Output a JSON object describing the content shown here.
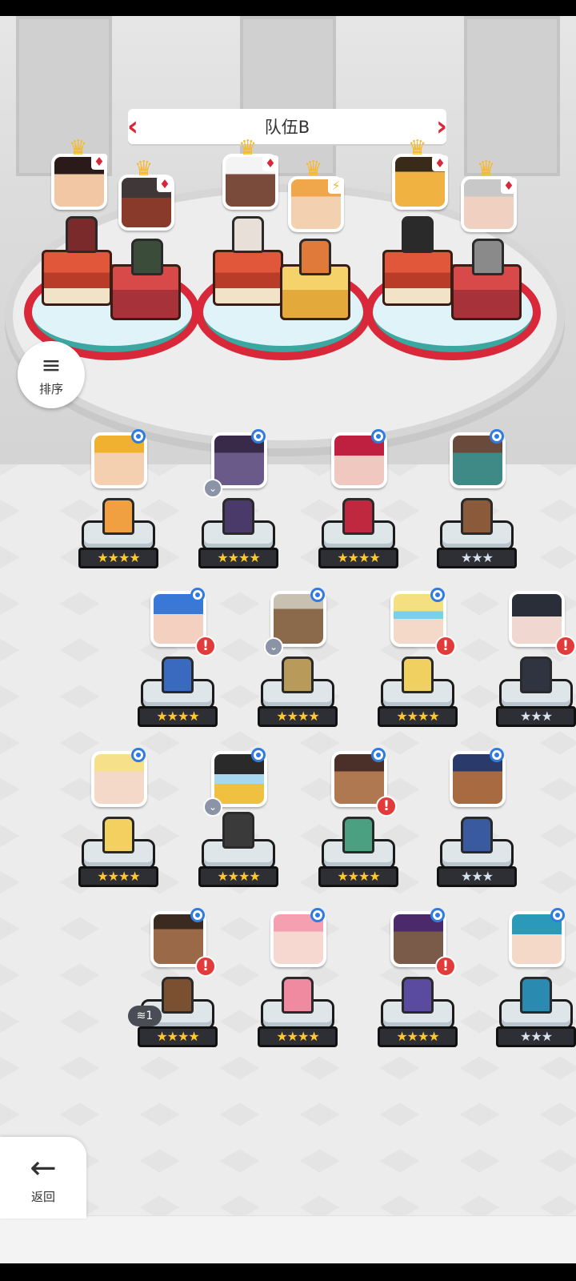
{
  "team": {
    "name": "队伍B"
  },
  "buttons": {
    "sort_label": "排序",
    "back_label": "返回"
  },
  "colors": {
    "accent_red": "#d8283a",
    "star_gold": "#ffc928",
    "star_silver": "#d8e2ee",
    "badge_blue": "#2f7be0"
  },
  "formation": [
    {
      "suit": "♦",
      "platform": "cake"
    },
    {
      "suit": "♦",
      "platform": "heart"
    },
    {
      "suit": "♦",
      "platform": "cake"
    },
    {
      "suit": "⚡",
      "platform": "gold"
    },
    {
      "suit": "♦",
      "platform": "cake"
    },
    {
      "suit": "♦",
      "platform": "heart"
    }
  ],
  "roster": {
    "row1": [
      {
        "stars": "★★★★"
      },
      {
        "stars": "★★★★"
      },
      {
        "stars": "★★★★"
      },
      {
        "stars": "★★★"
      }
    ],
    "row2": [
      {
        "stars": "★★★★"
      },
      {
        "stars": "★★★★"
      },
      {
        "stars": "★★★★"
      },
      {
        "stars": "★★★"
      }
    ],
    "row3": [
      {
        "stars": "★★★★"
      },
      {
        "stars": "★★★★"
      },
      {
        "stars": "★★★★"
      },
      {
        "stars": "★★★"
      }
    ],
    "row4": [
      {
        "stars": "★★★★"
      },
      {
        "stars": "★★★★"
      },
      {
        "stars": "★★★★"
      },
      {
        "stars": "★★★"
      }
    ]
  },
  "level_tag": "1"
}
